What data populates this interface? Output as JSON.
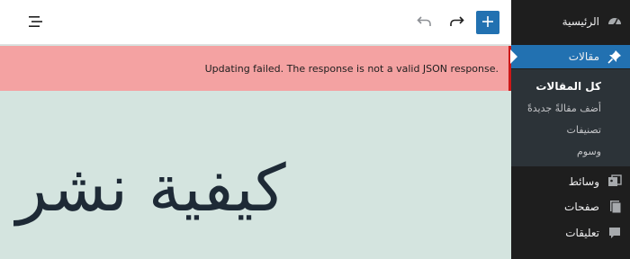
{
  "sidebar": {
    "items": [
      {
        "label": "الرئيسية",
        "icon": "dashboard-icon"
      },
      {
        "label": "مقالات",
        "icon": "pin-icon",
        "current": true
      },
      {
        "label": "وسائط",
        "icon": "media-icon"
      },
      {
        "label": "صفحات",
        "icon": "pages-icon"
      },
      {
        "label": "تعليقات",
        "icon": "comments-icon"
      }
    ],
    "submenu": [
      {
        "label": "كل المقالات",
        "active": true
      },
      {
        "label": "أضف مقالةً جديدةً"
      },
      {
        "label": "تصنيفات"
      },
      {
        "label": "وسوم"
      }
    ]
  },
  "toolbar": {
    "buttons": [
      "add-block",
      "redo",
      "undo",
      "document-overview"
    ],
    "accent": "#2271b1"
  },
  "notice": {
    "text": "Updating failed. The response is not a valid JSON response.",
    "status": "error",
    "color": "#cc1818"
  },
  "editor": {
    "title": "كيفية نشر"
  },
  "colors": {
    "sidebar_bg": "#1e1e1e",
    "submenu_bg": "#2c3338",
    "current_item": "#2271b1",
    "notice_bg": "#f4a2a2",
    "canvas_bg": "#d4e4df"
  }
}
